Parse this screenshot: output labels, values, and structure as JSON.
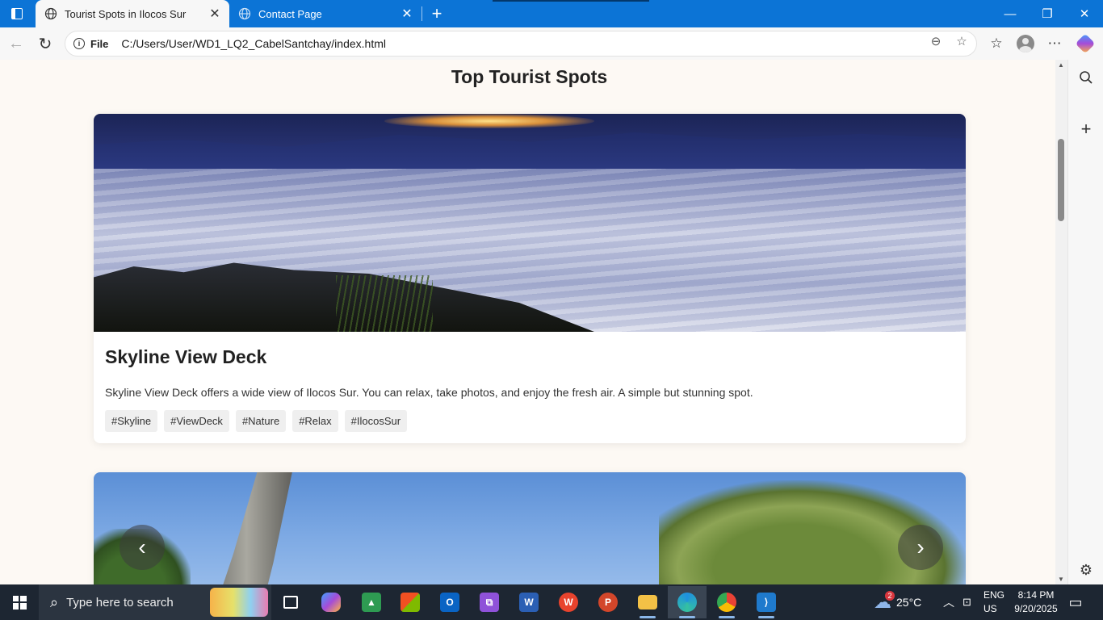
{
  "browser": {
    "tabs": [
      {
        "label": "Tourist Spots in Ilocos Sur",
        "active": true
      },
      {
        "label": "Contact Page",
        "active": false
      }
    ],
    "address": {
      "scheme_label": "File",
      "url": "C:/Users/User/WD1_LQ2_CabelSantchay/index.html"
    },
    "icons": {
      "sidebar_toggle": "tab-actions-icon",
      "globe": "globe-icon",
      "new_tab": "plus-icon",
      "back": "arrow-left-icon",
      "refresh": "refresh-icon",
      "info": "info-icon",
      "zoom": "zoom-out-icon",
      "favorite": "star-icon",
      "favorites": "favorites-icon",
      "profile": "profile-icon",
      "more": "more-icon",
      "copilot": "copilot-icon"
    }
  },
  "page": {
    "heading": "Top Tourist Spots",
    "cards": [
      {
        "title": "Skyline View Deck",
        "description": "Skyline View Deck offers a wide view of Ilocos Sur. You can relax, take photos, and enjoy the fresh air. A simple but stunning spot.",
        "tags": [
          "#Skyline",
          "#ViewDeck",
          "#Nature",
          "#Relax",
          "#IlocosSur"
        ]
      }
    ],
    "carousel": {
      "prev_icon": "chevron-left-icon",
      "next_icon": "chevron-right-icon"
    }
  },
  "taskbar": {
    "search_placeholder": "Type here to search",
    "weather": {
      "badge": "2",
      "temp": "25°C"
    },
    "language": {
      "line1": "ENG",
      "line2": "US"
    },
    "clock": {
      "time": "8:14 PM",
      "date": "9/20/2025"
    },
    "colors": {
      "taskbar_bg": "#1d2632",
      "accent": "#0c74d6"
    }
  }
}
